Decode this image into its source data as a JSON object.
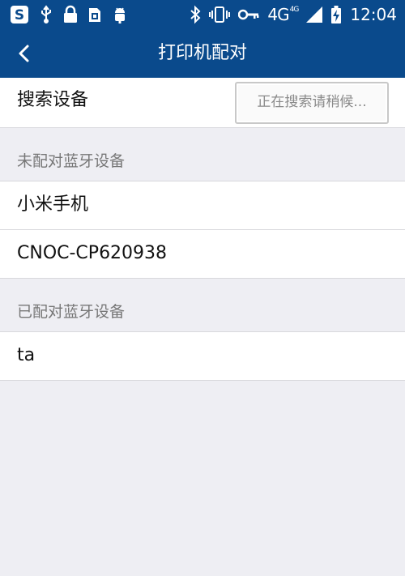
{
  "status_bar": {
    "network": "4G",
    "network_sup": "4G",
    "time": "12:04"
  },
  "header": {
    "title": "打印机配对"
  },
  "search": {
    "label": "搜索设备",
    "status_button": "正在搜索请稍候..."
  },
  "unpaired": {
    "header": "未配对蓝牙设备",
    "devices": [
      "小米手机",
      "CNOC-CP620938"
    ]
  },
  "paired": {
    "header": "已配对蓝牙设备",
    "devices": [
      "ta"
    ]
  },
  "colors": {
    "primary": "#0a4a8c",
    "background": "#eeeef3",
    "divider": "#d8d8dc"
  }
}
